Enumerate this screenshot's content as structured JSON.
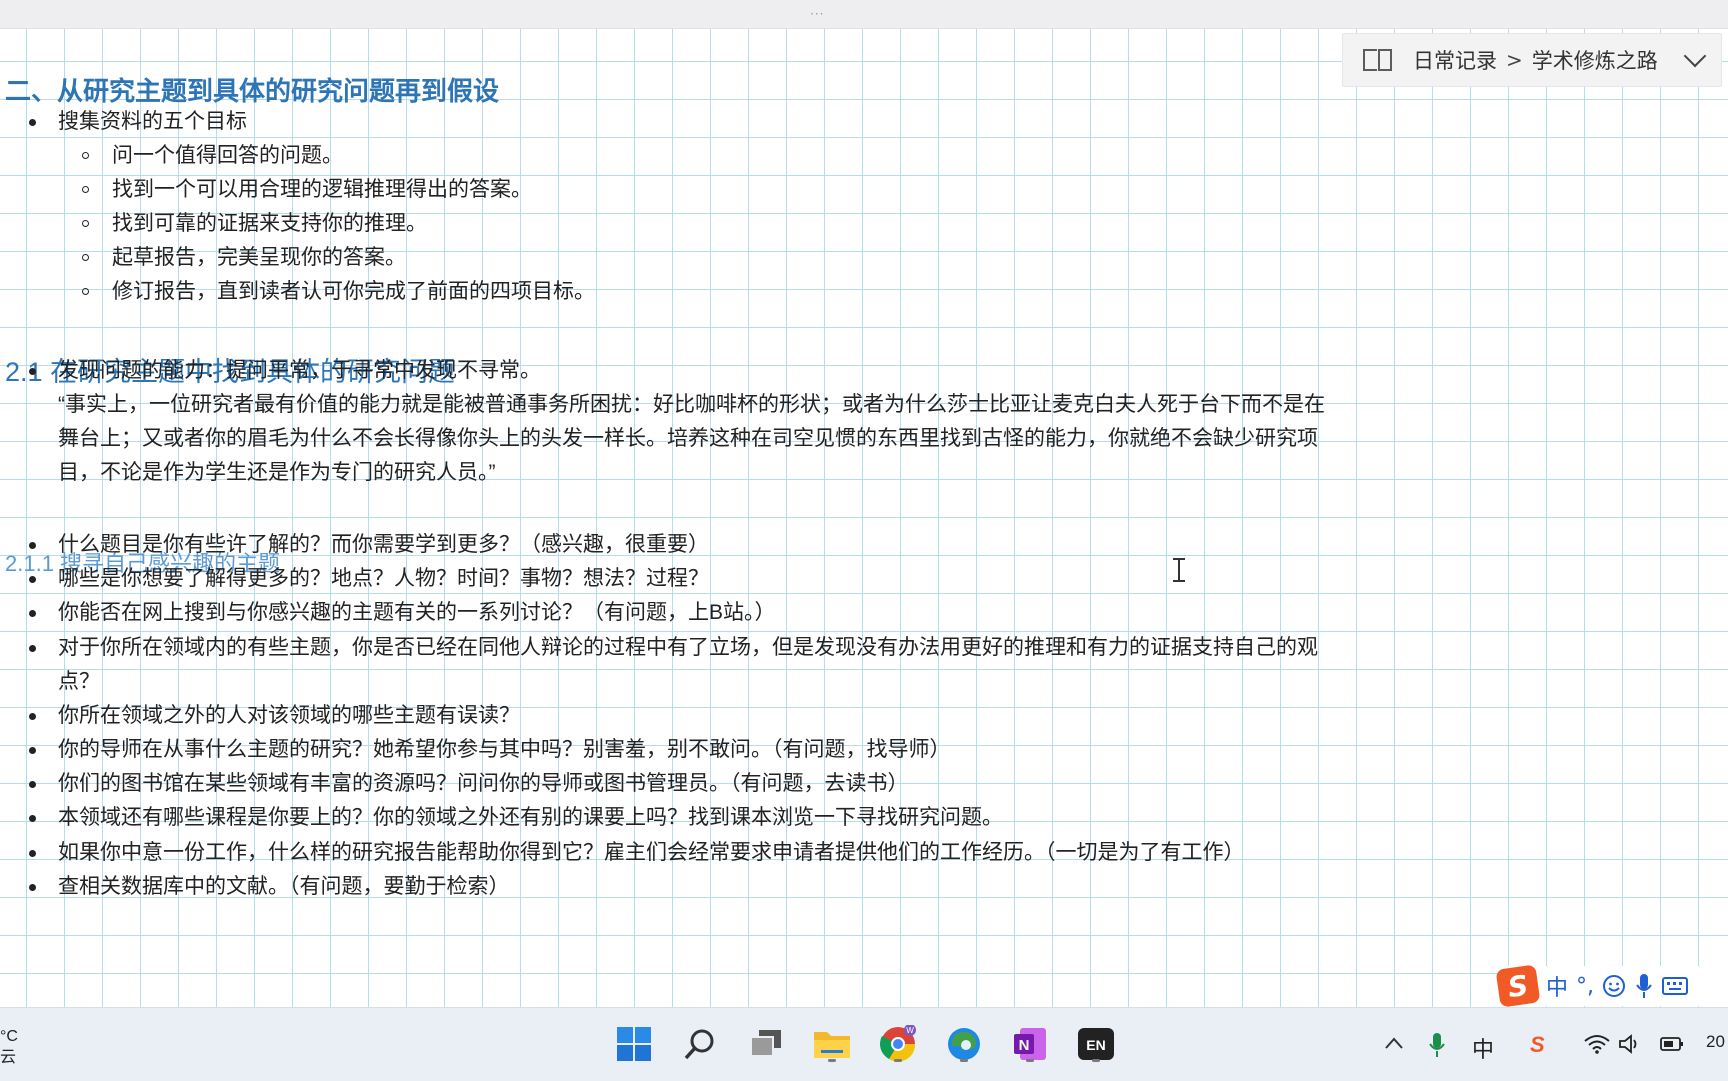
{
  "window": {
    "drag_handle": "···"
  },
  "breadcrumb": {
    "icon": "notebook-icon",
    "notebook": "日常记录",
    "separator": ">",
    "section": "学术修炼之路",
    "chevron": "chevron-down-icon"
  },
  "note": {
    "heading1": "二、从研究主题到具体的研究问题再到假设",
    "goals_title": "搜集资料的五个目标",
    "goals": [
      "问一个值得回答的问题。",
      "找到一个可以用合理的逻辑推理得出的答案。",
      "找到可靠的证据来支持你的推理。",
      "起草报告，完美呈现你的答案。",
      "修订报告，直到读者认可你完成了前面的四项目标。"
    ],
    "heading2": "2.1 在研究主题中找到具体的研究问题",
    "ability": "发现问题的能力：提问平常，于寻常中发现不寻常。",
    "quote_lines": [
      "“事实上，一位研究者最有价值的能力就是能被普通事务所困扰：好比咖啡杯的形状；或者为什么莎士比亚让麦克白夫人死于台下而不是在",
      "舞台上；又或者你的眉毛为什么不会长得像你头上的头发一样长。培养这种在司空见惯的东西里找到古怪的能力，你就绝不会缺少研究项",
      "目，不论是作为学生还是作为专门的研究人员。”"
    ],
    "heading3": "2.1.1 搜寻自己感兴趣的主题",
    "items": [
      "什么题目是你有些许了解的？而你需要学到更多？（感兴趣，很重要）",
      "哪些是你想要了解得更多的？地点？人物？时间？事物？想法？过程？",
      "你能否在网上搜到与你感兴趣的主题有关的一系列讨论？（有问题，上B站。）",
      "对于你所在领域内的有些主题，你是否已经在同他人辩论的过程中有了立场，但是发现没有办法用更好的推理和有力的证据支持自己的观",
      "点？",
      "你所在领域之外的人对该领域的哪些主题有误读？",
      "你的导师在从事什么主题的研究？她希望你参与其中吗？别害羞，别不敢问。（有问题，找导师）",
      "你们的图书馆在某些领域有丰富的资源吗？问问你的导师或图书管理员。（有问题，去读书）",
      "本领域还有哪些课程是你要上的？你的领域之外还有别的课要上吗？找到课本浏览一下寻找研究问题。",
      "如果你中意一份工作，什么样的研究报告能帮助你得到它？雇主们会经常要求申请者提供他们的工作经历。（一切是为了有工作）",
      "查相关数据库中的文献。（有问题，要勤于检索）"
    ]
  },
  "ime": {
    "logo": "S",
    "mode": "中",
    "punct": "°,",
    "icons": [
      "emoji-icon",
      "microphone-icon",
      "keyboard-icon"
    ]
  },
  "taskbar": {
    "weather_temp": "°C",
    "weather_cond": "云",
    "apps": [
      "start-icon",
      "search-icon",
      "task-view-icon",
      "file-explorer-icon",
      "chrome-icon",
      "edge-icon",
      "onenote-icon",
      "en-app-icon"
    ],
    "en_label": "EN",
    "onenote_label": "N",
    "chrome_badge": "W",
    "tray_lang": "中",
    "tray_sogou": "S",
    "clock_partial": "20"
  },
  "colors": {
    "heading": "#2e75b5",
    "heading3": "#5b9bd5",
    "grid": "#b7dcec",
    "sogou": "#f15a24"
  }
}
